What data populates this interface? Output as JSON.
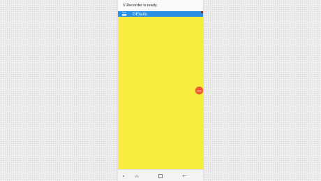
{
  "toast": {
    "message": "V Recorder is ready."
  },
  "appbar": {
    "title": "DEtails",
    "menu_icon": "hamburger-menu-icon",
    "color": "#2b8fe6"
  },
  "content": {
    "background_color": "#f8ec3c"
  },
  "floating_button": {
    "label": "Stop",
    "icon": "record-stop-icon",
    "color": "#ef5a2f"
  },
  "navbar": {
    "items": [
      {
        "name": "nav-dot",
        "icon": "dot-icon"
      },
      {
        "name": "recent-apps",
        "icon": "recent-apps-icon"
      },
      {
        "name": "home",
        "icon": "home-square-icon"
      },
      {
        "name": "back",
        "icon": "back-arrow-icon"
      }
    ]
  }
}
